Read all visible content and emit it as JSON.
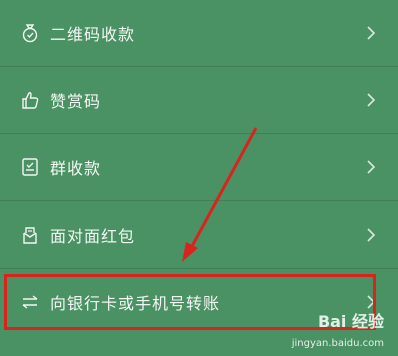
{
  "menu": {
    "items": [
      {
        "label": "二维码收款",
        "icon": "money-bag-icon"
      },
      {
        "label": "赞赏码",
        "icon": "thumbs-up-icon"
      },
      {
        "label": "群收款",
        "icon": "group-receipt-icon"
      },
      {
        "label": "面对面红包",
        "icon": "red-packet-icon"
      },
      {
        "label": "向银行卡或手机号转账",
        "icon": "transfer-arrows-icon"
      }
    ]
  },
  "watermark": {
    "text": "Bai 经验",
    "url": "jingyan.baidu.com"
  },
  "colors": {
    "background": "#4a9263",
    "text": "#f2f7f3",
    "highlight": "#d9231f"
  }
}
